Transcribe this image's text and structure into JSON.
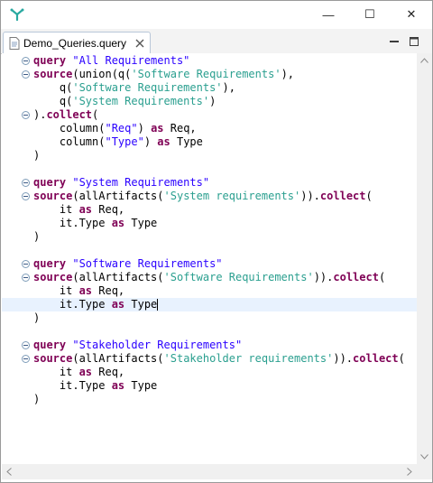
{
  "window": {
    "controls": {
      "minimize": "—",
      "maximize": "☐",
      "close": "✕"
    }
  },
  "tab": {
    "label": "Demo_Queries.query"
  },
  "code_lines": [
    {
      "fold": true,
      "tokens": [
        [
          "kw",
          "query"
        ],
        [
          "sep",
          " "
        ],
        [
          "str",
          "\"All Requirements\""
        ]
      ]
    },
    {
      "fold": true,
      "tokens": [
        [
          "kw",
          "source"
        ],
        [
          "sep",
          "(union(q("
        ],
        [
          "lit",
          "'Software Requirements'"
        ],
        [
          "sep",
          "),"
        ]
      ]
    },
    {
      "fold": false,
      "tokens": [
        [
          "sep",
          "    q("
        ],
        [
          "lit",
          "'Software Requirements'"
        ],
        [
          "sep",
          "),"
        ]
      ]
    },
    {
      "fold": false,
      "tokens": [
        [
          "sep",
          "    q("
        ],
        [
          "lit",
          "'System Requirements'"
        ],
        [
          "sep",
          ")"
        ]
      ]
    },
    {
      "fold": true,
      "tokens": [
        [
          "sep",
          ")."
        ],
        [
          "kw",
          "collect"
        ],
        [
          "sep",
          "("
        ]
      ]
    },
    {
      "fold": false,
      "tokens": [
        [
          "sep",
          "    column("
        ],
        [
          "str",
          "\"Req\""
        ],
        [
          "sep",
          ") "
        ],
        [
          "kw",
          "as"
        ],
        [
          "sep",
          " Req,"
        ]
      ]
    },
    {
      "fold": false,
      "tokens": [
        [
          "sep",
          "    column("
        ],
        [
          "str",
          "\"Type\""
        ],
        [
          "sep",
          ") "
        ],
        [
          "kw",
          "as"
        ],
        [
          "sep",
          " Type"
        ]
      ]
    },
    {
      "fold": false,
      "tokens": [
        [
          "sep",
          ")"
        ]
      ]
    },
    {
      "fold": false,
      "tokens": []
    },
    {
      "fold": true,
      "tokens": [
        [
          "kw",
          "query"
        ],
        [
          "sep",
          " "
        ],
        [
          "str",
          "\"System Requirements\""
        ]
      ]
    },
    {
      "fold": true,
      "tokens": [
        [
          "kw",
          "source"
        ],
        [
          "sep",
          "(allArtifacts("
        ],
        [
          "lit",
          "'System requirements'"
        ],
        [
          "sep",
          "))."
        ],
        [
          "kw",
          "collect"
        ],
        [
          "sep",
          "("
        ]
      ]
    },
    {
      "fold": false,
      "tokens": [
        [
          "sep",
          "    it "
        ],
        [
          "kw",
          "as"
        ],
        [
          "sep",
          " Req,"
        ]
      ]
    },
    {
      "fold": false,
      "tokens": [
        [
          "sep",
          "    it.Type "
        ],
        [
          "kw",
          "as"
        ],
        [
          "sep",
          " Type"
        ]
      ]
    },
    {
      "fold": false,
      "tokens": [
        [
          "sep",
          ")"
        ]
      ]
    },
    {
      "fold": false,
      "tokens": []
    },
    {
      "fold": true,
      "tokens": [
        [
          "kw",
          "query"
        ],
        [
          "sep",
          " "
        ],
        [
          "str",
          "\"Software Requirements\""
        ]
      ]
    },
    {
      "fold": true,
      "tokens": [
        [
          "kw",
          "source"
        ],
        [
          "sep",
          "(allArtifacts("
        ],
        [
          "lit",
          "'Software Requirements'"
        ],
        [
          "sep",
          "))."
        ],
        [
          "kw",
          "collect"
        ],
        [
          "sep",
          "("
        ]
      ]
    },
    {
      "fold": false,
      "tokens": [
        [
          "sep",
          "    it "
        ],
        [
          "kw",
          "as"
        ],
        [
          "sep",
          " Req,"
        ]
      ]
    },
    {
      "fold": false,
      "current": true,
      "caret": true,
      "tokens": [
        [
          "sep",
          "    it.Type "
        ],
        [
          "kw",
          "as"
        ],
        [
          "sep",
          " Type"
        ]
      ]
    },
    {
      "fold": false,
      "tokens": [
        [
          "sep",
          ")"
        ]
      ]
    },
    {
      "fold": false,
      "tokens": []
    },
    {
      "fold": true,
      "tokens": [
        [
          "kw",
          "query"
        ],
        [
          "sep",
          " "
        ],
        [
          "str",
          "\"Stakeholder Requirements\""
        ]
      ]
    },
    {
      "fold": true,
      "tokens": [
        [
          "kw",
          "source"
        ],
        [
          "sep",
          "(allArtifacts("
        ],
        [
          "lit",
          "'Stakeholder requirements'"
        ],
        [
          "sep",
          "))."
        ],
        [
          "kw",
          "collect"
        ],
        [
          "sep",
          "("
        ]
      ]
    },
    {
      "fold": false,
      "tokens": [
        [
          "sep",
          "    it "
        ],
        [
          "kw",
          "as"
        ],
        [
          "sep",
          " Req,"
        ]
      ]
    },
    {
      "fold": false,
      "tokens": [
        [
          "sep",
          "    it.Type "
        ],
        [
          "kw",
          "as"
        ],
        [
          "sep",
          " Type"
        ]
      ]
    },
    {
      "fold": false,
      "tokens": [
        [
          "sep",
          ")"
        ]
      ]
    }
  ],
  "icons": {
    "app": "app-logo-icon",
    "file": "query-file-icon",
    "tab_close": "close-icon",
    "view_minimize": "minimize-view-icon",
    "view_maximize": "maximize-view-icon"
  },
  "colors": {
    "keyword": "#7f0055",
    "string": "#2a00ff",
    "literal": "#2a9f8f",
    "current_line": "#e8f2fe",
    "app_logo": "#29a9a0"
  }
}
